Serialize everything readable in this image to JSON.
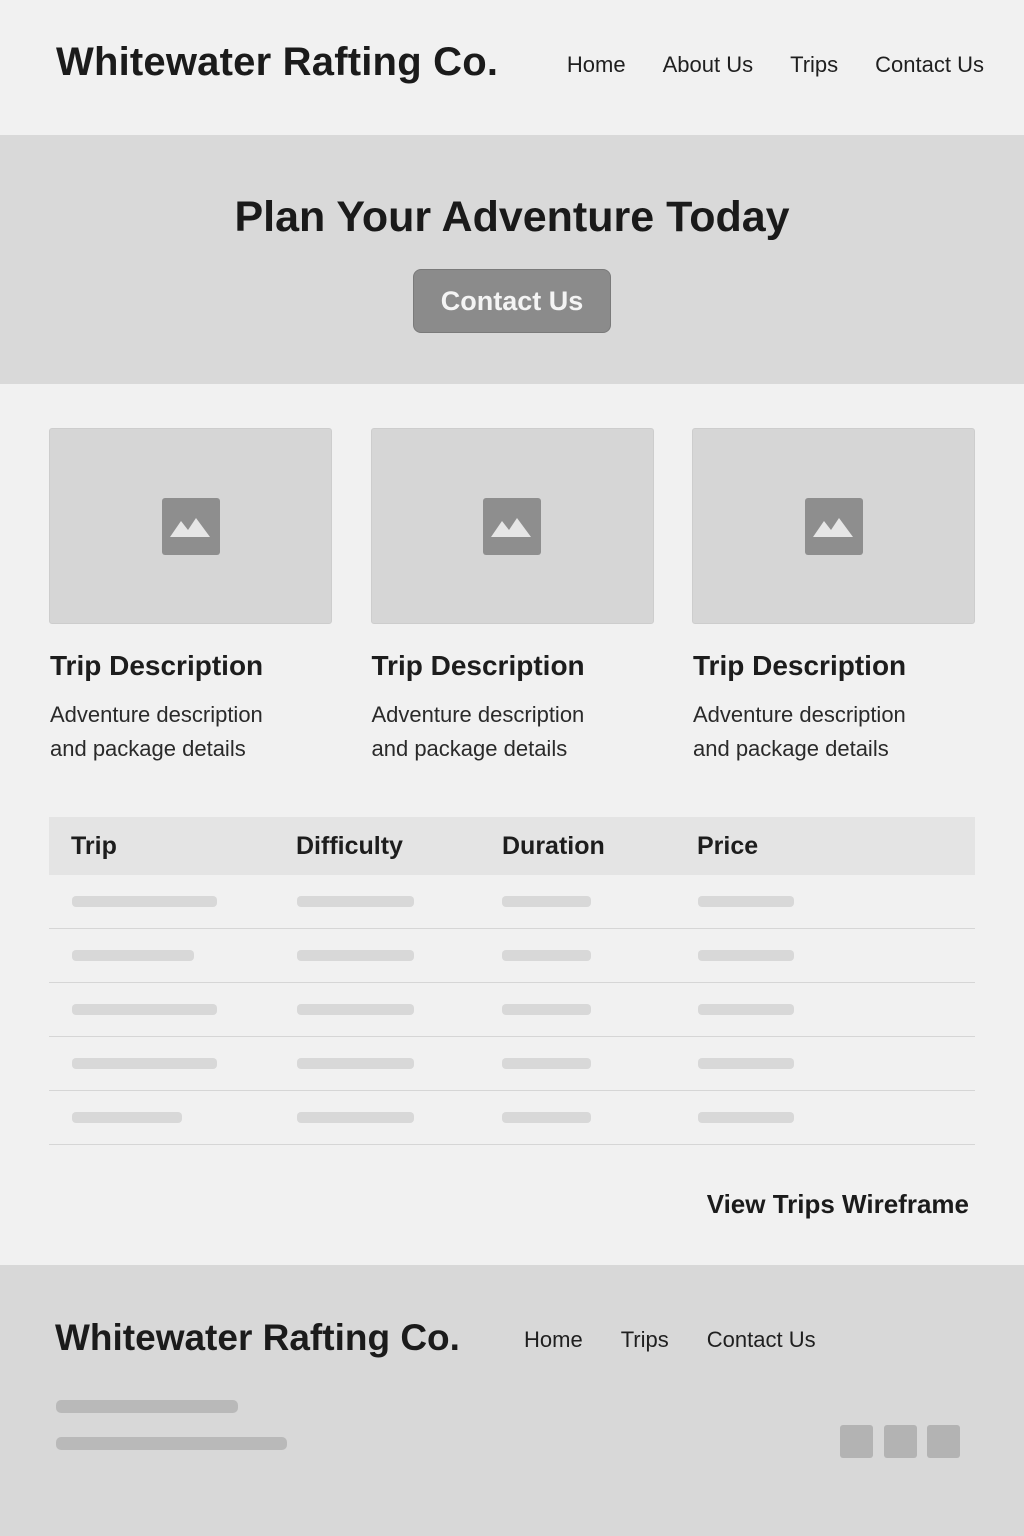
{
  "header": {
    "brand": "Whitewater Rafting Co.",
    "nav": [
      "Home",
      "About Us",
      "Trips",
      "Contact Us"
    ]
  },
  "hero": {
    "title": "Plan Your Adventure Today",
    "cta_label": "Contact Us"
  },
  "cards": [
    {
      "icon": "image-placeholder-icon",
      "title": "Trip Description",
      "description": "Adventure description and package details"
    },
    {
      "icon": "image-placeholder-icon",
      "title": "Trip Description",
      "description": "Adventure description and package details"
    },
    {
      "icon": "image-placeholder-icon",
      "title": "Trip Description",
      "description": "Adventure description and package details"
    }
  ],
  "table": {
    "headers": [
      "Trip",
      "Difficulty",
      "Duration",
      "Price"
    ],
    "row_count": 5
  },
  "view_link": "View Trips Wireframe",
  "footer": {
    "brand": "Whitewater Rafting Co.",
    "nav": [
      "Home",
      "Trips",
      "Contact Us"
    ],
    "social_icons": [
      "social-icon",
      "social-icon",
      "social-icon"
    ]
  },
  "colors": {
    "page_bg": "#f1f1f1",
    "hero_bg": "#d9d9d9",
    "button_bg": "#8b8b8b",
    "footer_bg": "#d8d8d8"
  }
}
